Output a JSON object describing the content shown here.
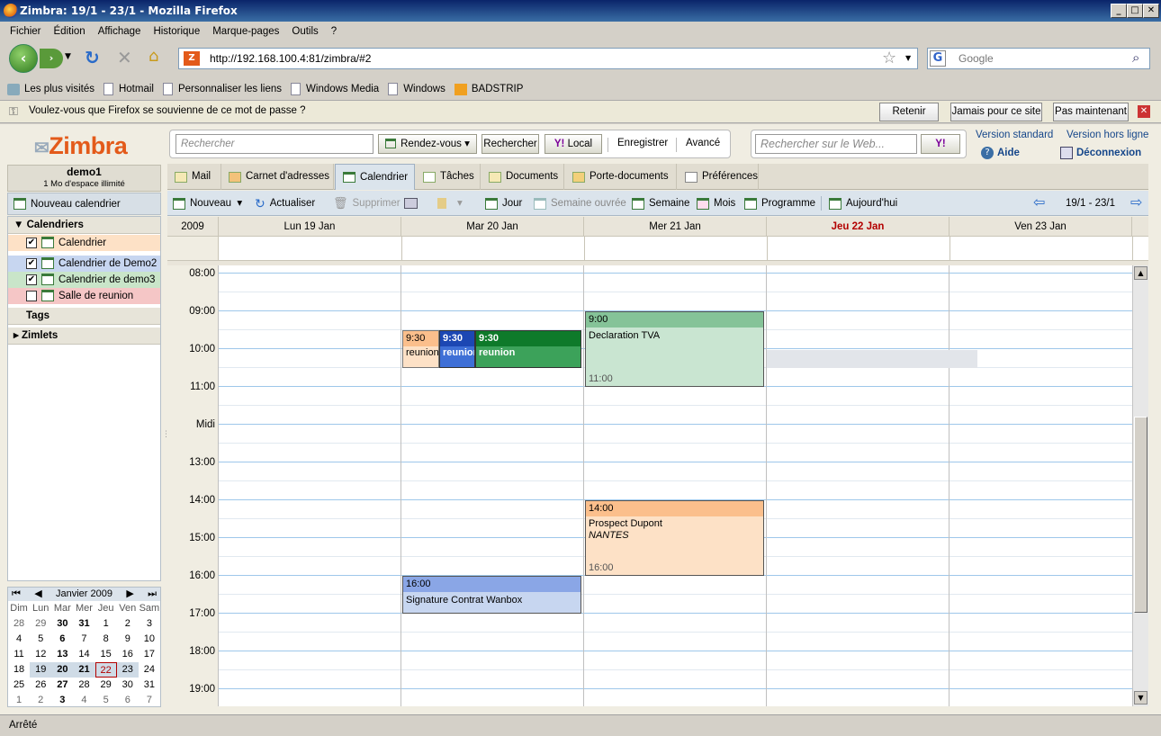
{
  "window": {
    "title": "Zimbra: 19/1 - 23/1 - Mozilla Firefox"
  },
  "menu": [
    "Fichier",
    "Édition",
    "Affichage",
    "Historique",
    "Marque-pages",
    "Outils",
    "?"
  ],
  "nav": {
    "url": "http://192.168.100.4:81/zimbra/#2",
    "search_placeholder": "Google"
  },
  "bookmarks": [
    "Les plus visités",
    "Hotmail",
    "Personnaliser les liens",
    "Windows Media",
    "Windows",
    "BADSTRIP"
  ],
  "notification": {
    "text": "Voulez-vous que Firefox se souvienne de ce mot de passe ?",
    "btn_retain": "Retenir",
    "btn_never": "Jamais pour ce site",
    "btn_not_now": "Pas maintenant"
  },
  "zimbra": {
    "logo": "Zimbra",
    "search_placeholder": "Rechercher",
    "rdv_label": "Rendez-vous",
    "search_btn": "Rechercher",
    "local_btn": "Local",
    "save_btn": "Enregistrer",
    "advanced_btn": "Avancé",
    "web_search_placeholder": "Rechercher sur le Web...",
    "standard_version": "Version standard",
    "offline_version": "Version hors ligne",
    "help": "Aide",
    "logout": "Déconnexion"
  },
  "account": {
    "name": "demo1",
    "quota": "1 Mo d'espace illimité"
  },
  "left": {
    "new_calendar": "Nouveau calendrier",
    "calendars_header": "Calendriers",
    "calendars": [
      {
        "label": "Calendrier",
        "checked": true,
        "color": "#fde1c6"
      },
      {
        "label": "Calendrier de Demo2",
        "checked": true,
        "color": "#c7d6f0"
      },
      {
        "label": "Calendrier de demo3",
        "checked": true,
        "color": "#c9e5c9"
      },
      {
        "label": "Salle de reunion",
        "checked": false,
        "color": "#f5c6c6"
      }
    ],
    "tags_header": "Tags",
    "zimlets_header": "Zimlets"
  },
  "minical": {
    "month": "Janvier 2009",
    "weekdays": [
      "Dim",
      "Lun",
      "Mar",
      "Mer",
      "Jeu",
      "Ven",
      "Sam"
    ],
    "weeks": [
      [
        "28",
        "29",
        "30",
        "31",
        "1",
        "2",
        "3"
      ],
      [
        "4",
        "5",
        "6",
        "7",
        "8",
        "9",
        "10"
      ],
      [
        "11",
        "12",
        "13",
        "14",
        "15",
        "16",
        "17"
      ],
      [
        "18",
        "19",
        "20",
        "21",
        "22",
        "23",
        "24"
      ],
      [
        "25",
        "26",
        "27",
        "28",
        "29",
        "30",
        "31"
      ],
      [
        "1",
        "2",
        "3",
        "4",
        "5",
        "6",
        "7"
      ]
    ]
  },
  "tabs": [
    "Mail",
    "Carnet d'adresses",
    "Calendrier",
    "Tâches",
    "Documents",
    "Porte-documents",
    "Préférences"
  ],
  "toolbar": {
    "new": "Nouveau",
    "refresh": "Actualiser",
    "delete": "Supprimer",
    "day": "Jour",
    "workweek": "Semaine ouvrée",
    "week": "Semaine",
    "month": "Mois",
    "schedule": "Programme",
    "today": "Aujourd'hui",
    "range": "19/1 - 23/1"
  },
  "calendar": {
    "year": "2009",
    "days": [
      "Lun 19 Jan",
      "Mar 20 Jan",
      "Mer 21 Jan",
      "Jeu 22 Jan",
      "Ven 23 Jan"
    ],
    "hours": [
      "08:00",
      "09:00",
      "10:00",
      "11:00",
      "Midi",
      "13:00",
      "14:00",
      "15:00",
      "16:00",
      "17:00",
      "18:00",
      "19:00"
    ],
    "appointments": [
      {
        "start": "9:30",
        "title": "reunion"
      },
      {
        "start": "9:30",
        "title": "reunion"
      },
      {
        "start": "9:30",
        "title": "reunion"
      },
      {
        "start": "9:00",
        "title": "Declaration TVA",
        "end": "11:00"
      },
      {
        "start": "14:00",
        "title": "Prospect Dupont",
        "location": "NANTES",
        "end": "16:00"
      },
      {
        "start": "16:00",
        "title": "Signature Contrat Wanbox"
      }
    ]
  },
  "status": "Arrêté",
  "colors": {
    "today": "#b30000",
    "accent": "#e35a1a"
  }
}
